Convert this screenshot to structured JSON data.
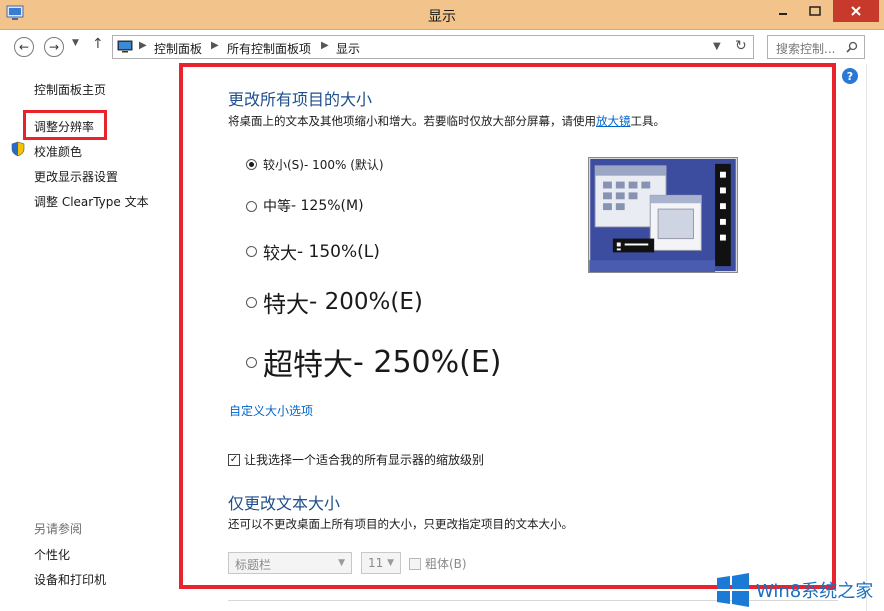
{
  "window": {
    "title": "显示"
  },
  "address": {
    "crumbs": [
      "控制面板",
      "所有控制面板项",
      "显示"
    ],
    "search_placeholder": "搜索控制..."
  },
  "leftnav": {
    "home": "控制面板主页",
    "items": [
      {
        "label": "调整分辨率"
      },
      {
        "label": "校准颜色"
      },
      {
        "label": "更改显示器设置"
      },
      {
        "label": "调整 ClearType 文本"
      }
    ],
    "see_also_title": "另请参阅",
    "see_also": [
      {
        "label": "个性化"
      },
      {
        "label": "设备和打印机"
      }
    ]
  },
  "main": {
    "size_heading": "更改所有项目的大小",
    "size_desc_before": "将桌面上的文本及其他项缩小和增大。若要临时仅放大部分屏幕，请使用",
    "size_desc_link": "放大镜",
    "size_desc_after": "工具。",
    "options": [
      {
        "name": "较小(S)",
        "detail": " - 100% (默认)",
        "selected": true
      },
      {
        "name": "中等",
        "detail": " - 125%(M)",
        "selected": false
      },
      {
        "name": "较大",
        "detail": " - 150%(L)",
        "selected": false
      },
      {
        "name": "特大",
        "detail": " - 200%(E)",
        "selected": false
      },
      {
        "name": "超特大",
        "detail": " - 250%(E)",
        "selected": false
      }
    ],
    "custom_link": "自定义大小选项",
    "checkbox_label": "让我选择一个适合我的所有显示器的缩放级别",
    "checkbox_checked": true,
    "text_heading": "仅更改文本大小",
    "text_desc": "还可以不更改桌面上所有项目的大小，只更改指定项目的文本大小。",
    "element_select": "标题栏",
    "font_size_select": "11",
    "bold_label": "粗体(B)"
  },
  "watermark": {
    "text": "Win8系统之家"
  },
  "colors": {
    "titlebar": "#f2c48c",
    "highlight_red": "#e8232e",
    "heading_blue": "#1e4e8c",
    "link_blue": "#0066cc"
  }
}
